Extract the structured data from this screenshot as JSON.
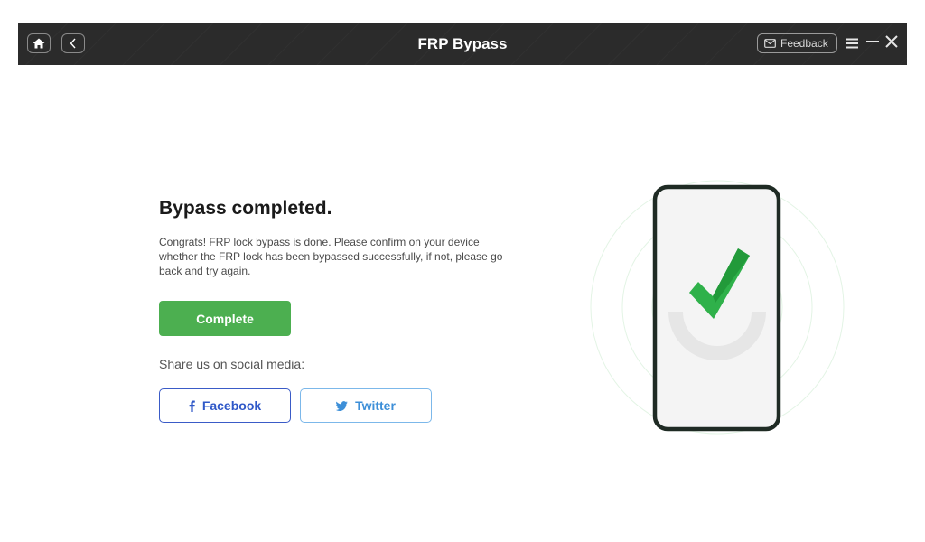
{
  "window": {
    "title": "FRP Bypass",
    "feedback_label": "Feedback"
  },
  "result": {
    "heading": "Bypass completed.",
    "description": "Congrats! FRP lock bypass is done. Please confirm on your device whether the FRP lock has been bypassed successfully, if not, please go back and try again.",
    "complete_label": "Complete"
  },
  "share": {
    "label": "Share us on social media:",
    "facebook_label": "Facebook",
    "twitter_label": "Twitter"
  },
  "colors": {
    "titlebar": "#2b2b2b",
    "accent_green": "#4caf50",
    "facebook": "#2f58c8",
    "twitter": "#3d8fd8"
  },
  "icons": [
    "home-icon",
    "back-icon",
    "mail-icon",
    "menu-icon",
    "minimize-icon",
    "close-icon",
    "facebook-icon",
    "twitter-icon",
    "checkmark-icon"
  ]
}
